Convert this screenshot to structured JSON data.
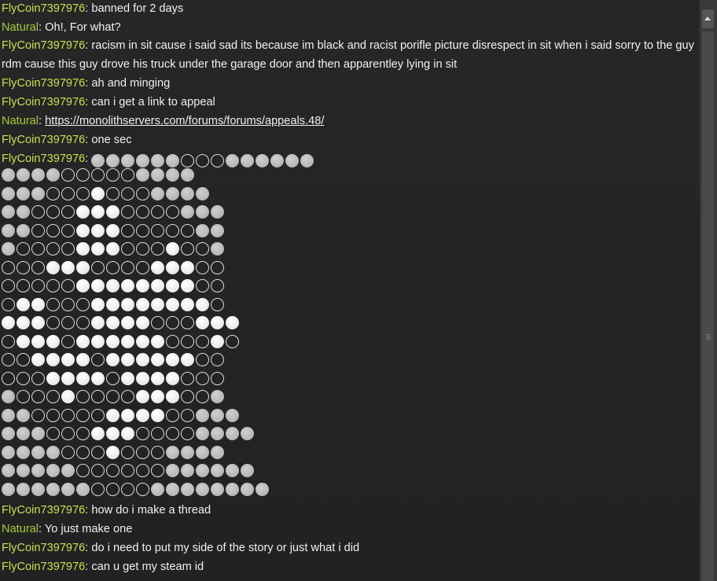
{
  "chat": {
    "messages": [
      {
        "sender": "FlyCoin7397976",
        "text": "banned for 2 days"
      },
      {
        "sender": "Natural",
        "text": "Oh!, For what?"
      },
      {
        "sender": "FlyCoin7397976",
        "text": "racism in sit cause i said sad its because im black and racist porifle picture disrespect in sit when i said sorry to the guy rdm cause this guy drove his truck under the garage door and then apparentley lying in sit"
      },
      {
        "sender": "FlyCoin7397976",
        "text": "ah and minging"
      },
      {
        "sender": "FlyCoin7397976",
        "text": "can i get a link to appeal"
      },
      {
        "sender": "Natural",
        "text": "https://monolithservers.com/forums/forums/appeals.48/"
      },
      {
        "sender": "FlyCoin7397976",
        "text": "one sec"
      },
      {
        "sender": "FlyCoin7397976",
        "text": ""
      },
      {
        "sender": "FlyCoin7397976",
        "text": "how do i make a thread"
      },
      {
        "sender": "Natural",
        "text": "Yo just make one"
      },
      {
        "sender": "FlyCoin7397976",
        "text": "do i need to put my side of the story or just what i did"
      },
      {
        "sender": "FlyCoin7397976",
        "text": "can u get my steam id"
      }
    ],
    "emoji_art": {
      "first_line": "ggggggooogggggg",
      "lines": [
        "ggggooooogggg",
        "gggooowooogggg",
        "ggooowwwooooggg",
        "ggooowwwooooogg",
        "goooowwwooowoog",
        "ooowwwoooowwwoo",
        "ooooowwwwwwwwoo",
        "owwooowwwwwwwwo",
        "wwwooowwwwooowww",
        "owwwowwwwwwooowo",
        "oowwwwowwwwwwoo",
        "ooowwwwowwwwooo",
        "gooowoooowwwoog",
        "ggooooowwwwooggg",
        "gggooowwwoooogggg",
        "ggggooowooogggg",
        "gggggoooooogggggg",
        "ggggggoooogggggggg"
      ]
    }
  }
}
